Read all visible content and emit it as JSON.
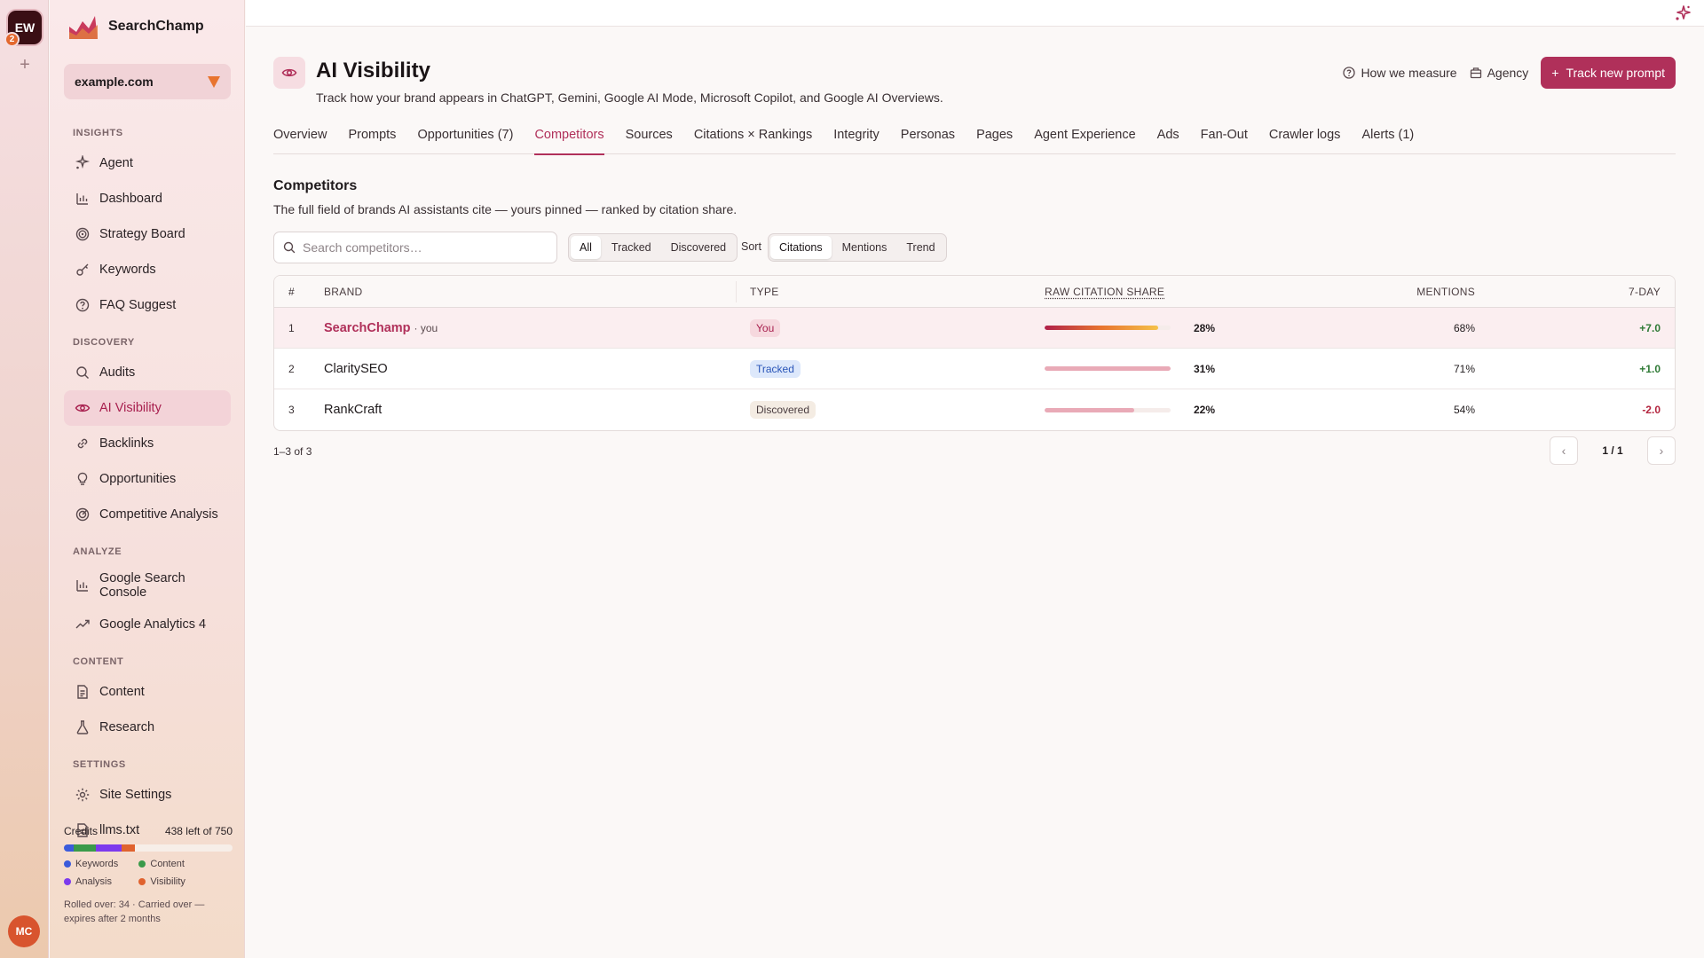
{
  "rail": {
    "workspace_initials": "EW",
    "workspace_badge": "2",
    "add_label": "+",
    "user_initials": "MC"
  },
  "brand": {
    "name": "SearchChamp"
  },
  "site": {
    "selected": "example.com"
  },
  "nav": {
    "sections": [
      {
        "title": "INSIGHTS",
        "items": [
          "Agent",
          "Dashboard",
          "Strategy Board",
          "Keywords",
          "FAQ Suggest"
        ]
      },
      {
        "title": "DISCOVERY",
        "items": [
          "Audits",
          "AI Visibility",
          "Backlinks",
          "Opportunities",
          "Competitive Analysis"
        ]
      },
      {
        "title": "ANALYZE",
        "items": [
          "Google Search Console",
          "Google Analytics 4"
        ]
      },
      {
        "title": "CONTENT",
        "items": [
          "Content",
          "Research"
        ]
      },
      {
        "title": "SETTINGS",
        "items": [
          "Site Settings",
          "llms.txt"
        ]
      }
    ],
    "active": "AI Visibility"
  },
  "credits": {
    "label": "Credits",
    "remaining": "438 left of 750",
    "legend": [
      "Keywords",
      "Content",
      "Analysis",
      "Visibility"
    ],
    "note": "Rolled over: 34 · Carried over — expires after 2 months",
    "colors": {
      "keywords": "#3b5bdb",
      "content": "#3a9a4a",
      "analysis": "#7c3aed",
      "visibility": "#e0622e"
    }
  },
  "header": {
    "title": "AI Visibility",
    "subtitle": "Track how your brand appears in ChatGPT, Gemini, Google AI Mode, Microsoft Copilot, and Google AI Overviews.",
    "how_we_measure": "How we measure",
    "agency": "Agency",
    "primary_button": "Track new prompt"
  },
  "tabs": {
    "items": [
      "Overview",
      "Prompts",
      "Opportunities (7)",
      "Competitors",
      "Sources",
      "Citations × Rankings",
      "Integrity",
      "Personas",
      "Pages",
      "Agent Experience",
      "Ads",
      "Fan-Out",
      "Crawler logs",
      "Alerts (1)"
    ],
    "active": "Competitors"
  },
  "section": {
    "title": "Competitors",
    "subtitle": "The full field of brands AI assistants cite — yours pinned — ranked by citation share."
  },
  "toolbar": {
    "search_placeholder": "Search competitors…",
    "filters": [
      "All",
      "Tracked",
      "Discovered"
    ],
    "filter_active": "All",
    "sort_label": "Sort",
    "sorts": [
      "Citations",
      "Mentions",
      "Trend"
    ],
    "sort_active": "Citations"
  },
  "table": {
    "headers": {
      "num": "#",
      "brand": "BRAND",
      "type": "TYPE",
      "share": "RAW CITATION SHARE",
      "mentions": "MENTIONS",
      "trend": "7-DAY"
    },
    "rows": [
      {
        "num": "1",
        "brand": "SearchChamp",
        "you_tag": "· you",
        "type": "You",
        "share_label": "28%",
        "share_fill": 0.9,
        "mentions": "68%",
        "trend": "+7.0",
        "trend_dir": "pos"
      },
      {
        "num": "2",
        "brand": "ClaritySEO",
        "you_tag": "",
        "type": "Tracked",
        "share_label": "31%",
        "share_fill": 1.0,
        "mentions": "71%",
        "trend": "+1.0",
        "trend_dir": "pos"
      },
      {
        "num": "3",
        "brand": "RankCraft",
        "you_tag": "",
        "type": "Discovered",
        "share_label": "22%",
        "share_fill": 0.71,
        "mentions": "54%",
        "trend": "-2.0",
        "trend_dir": "neg"
      }
    ]
  },
  "footer": {
    "count": "1–3 of 3",
    "page": "1 / 1"
  },
  "colors": {
    "accent": "#b0305a",
    "positive": "#2f7a36",
    "negative": "#b3243e"
  }
}
